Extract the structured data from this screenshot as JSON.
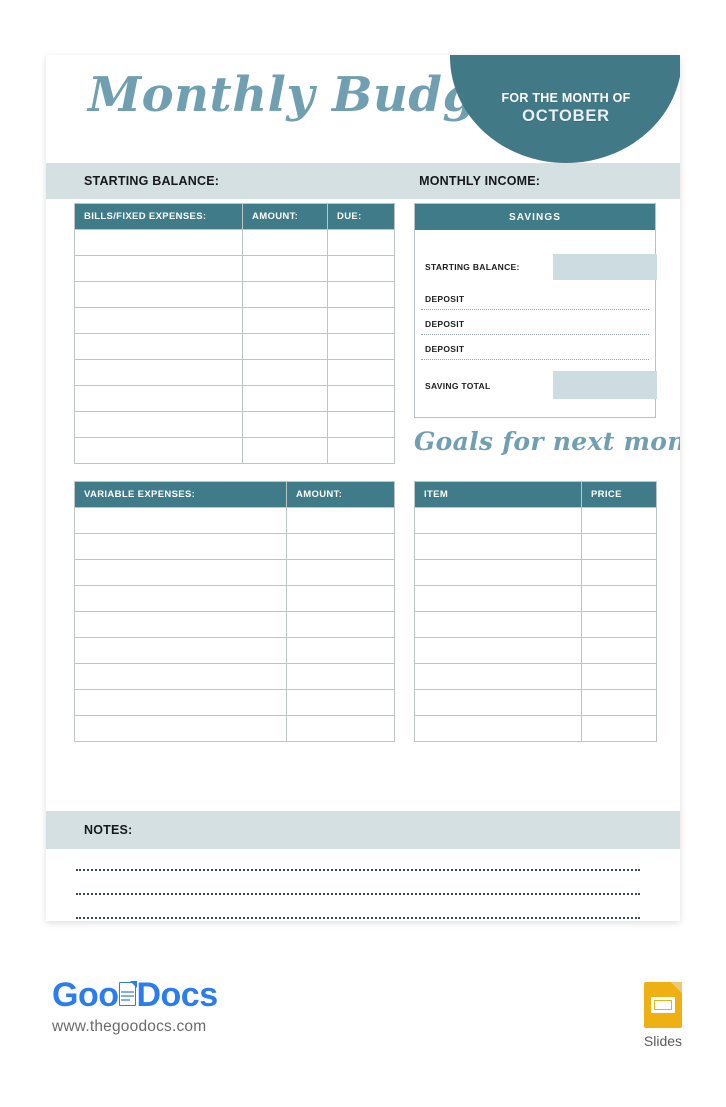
{
  "document": {
    "title": "Monthly Budget",
    "badge": {
      "line1": "FOR THE MONTH OF",
      "month": "OCTOBER"
    }
  },
  "balance_strip": {
    "starting_balance_label": "STARTING BALANCE:",
    "monthly_income_label": "MONTHLY INCOME:"
  },
  "bills_table": {
    "headers": [
      "BILLS/FIXED EXPENSES:",
      "AMOUNT:",
      "DUE:"
    ],
    "row_count": 9,
    "rows": [
      [
        "",
        "",
        ""
      ],
      [
        "",
        "",
        ""
      ],
      [
        "",
        "",
        ""
      ],
      [
        "",
        "",
        ""
      ],
      [
        "",
        "",
        ""
      ],
      [
        "",
        "",
        ""
      ],
      [
        "",
        "",
        ""
      ],
      [
        "",
        "",
        ""
      ],
      [
        "",
        "",
        ""
      ]
    ]
  },
  "variable_table": {
    "headers": [
      "VARIABLE EXPENSES:",
      "AMOUNT:"
    ],
    "row_count": 9,
    "rows": [
      [
        "",
        ""
      ],
      [
        "",
        ""
      ],
      [
        "",
        ""
      ],
      [
        "",
        ""
      ],
      [
        "",
        ""
      ],
      [
        "",
        ""
      ],
      [
        "",
        ""
      ],
      [
        "",
        ""
      ],
      [
        "",
        ""
      ]
    ]
  },
  "savings": {
    "heading": "SAVINGS",
    "starting_balance_label": "STARTING BALANCE:",
    "deposit_label_1": "DEPOSIT",
    "deposit_label_2": "DEPOSIT",
    "deposit_label_3": "DEPOSIT",
    "saving_total_label": "SAVING TOTAL",
    "starting_balance_value": "",
    "deposit_value_1": "",
    "deposit_value_2": "",
    "deposit_value_3": "",
    "saving_total_value": ""
  },
  "goals": {
    "heading": "Goals for next month",
    "headers": [
      "ITEM",
      "PRICE"
    ],
    "row_count": 9,
    "rows": [
      [
        "",
        ""
      ],
      [
        "",
        ""
      ],
      [
        "",
        ""
      ],
      [
        "",
        ""
      ],
      [
        "",
        ""
      ],
      [
        "",
        ""
      ],
      [
        "",
        ""
      ],
      [
        "",
        ""
      ],
      [
        "",
        ""
      ]
    ]
  },
  "notes": {
    "label": "NOTES:",
    "line_count": 3,
    "lines": [
      "",
      "",
      ""
    ]
  },
  "footer": {
    "brand_part1": "Goo",
    "brand_part2": "Docs",
    "url": "www.thegoodocs.com",
    "slides_label": "Slides"
  },
  "colors": {
    "teal_dark": "#3f7b88",
    "teal_badge": "#417986",
    "script_blue": "#6f9fb0",
    "strip_bg": "#d4e0e2",
    "field_fill": "#ccdce0",
    "border_grey": "#bfc5c7",
    "brand_blue": "#2b7cf0",
    "slides_yellow": "#efb014"
  }
}
